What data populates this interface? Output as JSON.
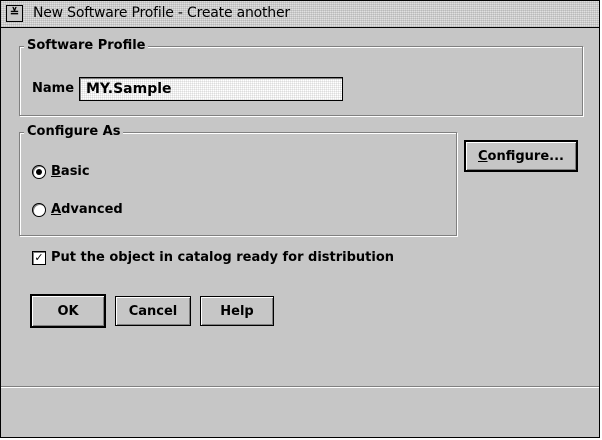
{
  "window": {
    "title": "New Software Profile - Create another",
    "sysmenu_glyph": "≚"
  },
  "software_profile": {
    "legend": "Software Profile",
    "name_label": "Name",
    "name_value": "MY.Sample"
  },
  "configure_as": {
    "legend": "Configure As",
    "options": [
      {
        "mnemonic": "B",
        "rest": "asic",
        "selected": true
      },
      {
        "mnemonic": "A",
        "rest": "dvanced",
        "selected": false
      }
    ]
  },
  "configure_button": {
    "mnemonic": "C",
    "rest": "onfigure..."
  },
  "catalog_checkbox": {
    "checked": true,
    "check_glyph": "✓",
    "label": "Put the object in catalog ready for distribution"
  },
  "buttons": {
    "ok": "OK",
    "cancel": "Cancel",
    "help": "Help"
  }
}
